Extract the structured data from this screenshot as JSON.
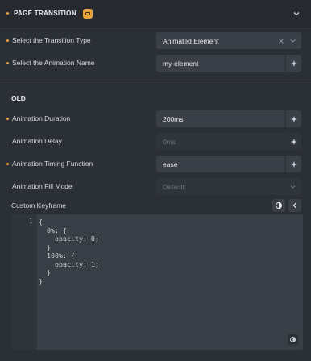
{
  "header": {
    "title": "PAGE TRANSITION"
  },
  "fields": {
    "transition_type": {
      "label": "Select the Transition Type",
      "value": "Animated Element"
    },
    "animation_name": {
      "label": "Select the Animation Name",
      "value": "my-element"
    }
  },
  "old_section": {
    "title": "OLD",
    "duration": {
      "label": "Animation Duration",
      "value": "200ms"
    },
    "delay": {
      "label": "Animation Delay",
      "placeholder": "0ms"
    },
    "timing": {
      "label": "Animation Timing Function",
      "value": "ease"
    },
    "fill_mode": {
      "label": "Animation Fill Mode",
      "placeholder": "Default"
    },
    "keyframe": {
      "label": "Custom Keyframe",
      "line_number": "1",
      "code": "{\n  0%: {\n    opacity: 0;\n  }\n  100%: {\n    opacity: 1;\n  }\n}"
    }
  },
  "colors": {
    "accent": "#e6a23c",
    "background": "#2b2f36",
    "input": "#3b4048"
  }
}
